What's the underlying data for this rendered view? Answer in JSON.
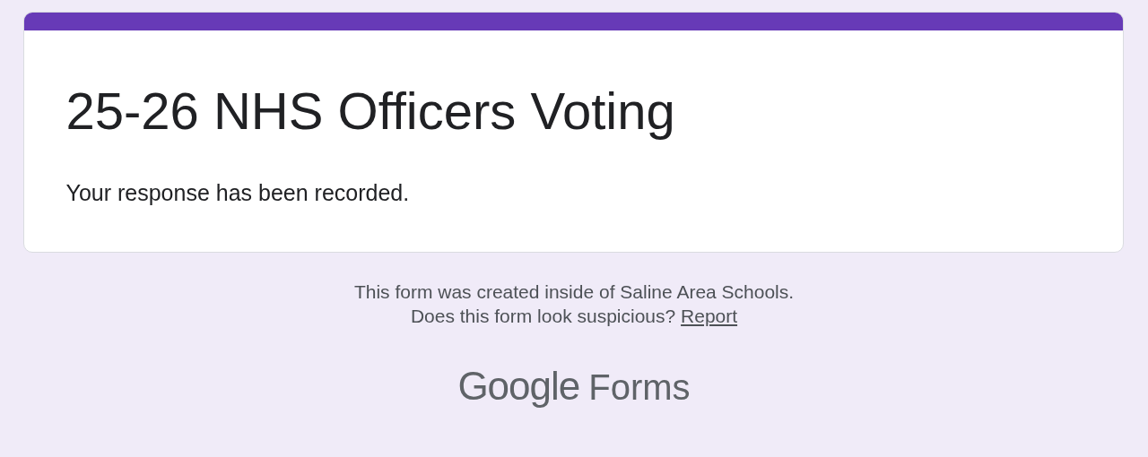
{
  "form": {
    "title": "25-26 NHS Officers Voting",
    "message": "Your response has been recorded."
  },
  "footer": {
    "notice": "This form was created inside of Saline Area Schools.",
    "question": "Does this form look suspicious?",
    "report_link": "Report"
  },
  "logo": {
    "brand": "Google",
    "product": "Forms"
  }
}
